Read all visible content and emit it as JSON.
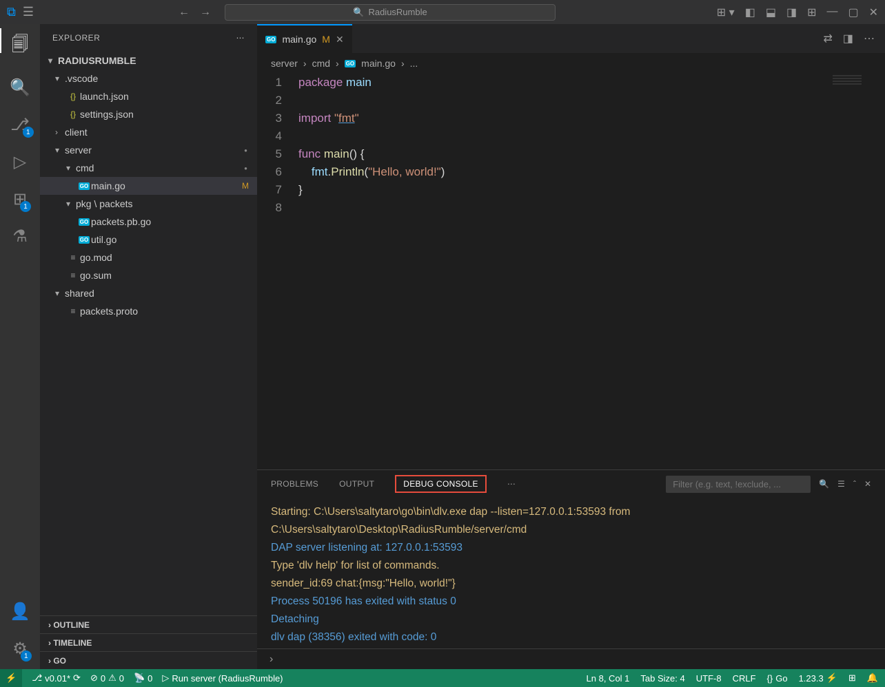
{
  "title": "RadiusRumble",
  "explorer": {
    "label": "EXPLORER"
  },
  "project": {
    "name": "RADIUSRUMBLE"
  },
  "tree": [
    {
      "type": "folder",
      "depth": 1,
      "label": ".vscode",
      "open": true
    },
    {
      "type": "file",
      "depth": 2,
      "label": "launch.json",
      "icon": "json"
    },
    {
      "type": "file",
      "depth": 2,
      "label": "settings.json",
      "icon": "json"
    },
    {
      "type": "folder",
      "depth": 1,
      "label": "client",
      "open": false
    },
    {
      "type": "folder",
      "depth": 1,
      "label": "server",
      "open": true,
      "dot": true
    },
    {
      "type": "folder",
      "depth": 2,
      "label": "cmd",
      "open": true,
      "dot": true
    },
    {
      "type": "file",
      "depth": 3,
      "label": "main.go",
      "icon": "go",
      "status": "M",
      "selected": true
    },
    {
      "type": "folder",
      "depth": 2,
      "label": "pkg \\ packets",
      "open": true
    },
    {
      "type": "file",
      "depth": 3,
      "label": "packets.pb.go",
      "icon": "go"
    },
    {
      "type": "file",
      "depth": 3,
      "label": "util.go",
      "icon": "go"
    },
    {
      "type": "file",
      "depth": 2,
      "label": "go.mod",
      "icon": "lines"
    },
    {
      "type": "file",
      "depth": 2,
      "label": "go.sum",
      "icon": "lines"
    },
    {
      "type": "folder",
      "depth": 1,
      "label": "shared",
      "open": true
    },
    {
      "type": "file",
      "depth": 2,
      "label": "packets.proto",
      "icon": "lines"
    }
  ],
  "sections": {
    "outline": "OUTLINE",
    "timeline": "TIMELINE",
    "go": "GO"
  },
  "tab": {
    "file": "main.go",
    "modified": "M"
  },
  "breadcrumb": {
    "p1": "server",
    "p2": "cmd",
    "p3": "main.go",
    "p4": "..."
  },
  "code": {
    "lines": [
      1,
      2,
      3,
      4,
      5,
      6,
      7,
      8
    ],
    "l1": {
      "a": "package",
      "b": "main"
    },
    "l3": {
      "a": "import",
      "b": "\"",
      "c": "fmt",
      "d": "\""
    },
    "l5": {
      "a": "func",
      "b": "main",
      "c": "() {"
    },
    "l6": {
      "a": "fmt",
      "b": ".",
      "c": "Println",
      "d": "(",
      "e": "\"Hello, world!\"",
      "f": ")"
    },
    "l7": "}"
  },
  "panel": {
    "tabs": {
      "problems": "PROBLEMS",
      "output": "OUTPUT",
      "debug": "DEBUG CONSOLE"
    },
    "filter_placeholder": "Filter (e.g. text, !exclude, ...",
    "lines": [
      {
        "c": "yellow",
        "t": "Starting: C:\\Users\\saltytaro\\go\\bin\\dlv.exe dap --listen=127.0.0.1:53593 from C:\\Users\\saltytaro\\Desktop\\RadiusRumble/server/cmd"
      },
      {
        "c": "blue",
        "t": "DAP server listening at: 127.0.0.1:53593"
      },
      {
        "c": "yellow",
        "t": "Type 'dlv help' for list of commands."
      },
      {
        "c": "yellow",
        "t": "sender_id:69  chat:{msg:\"Hello, world!\"}"
      },
      {
        "c": "blue",
        "t": "Process 50196 has exited with status 0"
      },
      {
        "c": "blue",
        "t": "Detaching"
      },
      {
        "c": "blue",
        "t": "dlv dap (38356) exited with code: 0"
      }
    ]
  },
  "status": {
    "branch": "v0.01*",
    "errors": "0",
    "warnings": "0",
    "ports": "0",
    "run": "Run server (RadiusRumble)",
    "lncol": "Ln 8, Col 1",
    "tabsize": "Tab Size: 4",
    "encoding": "UTF-8",
    "eol": "CRLF",
    "lang": "Go",
    "ver": "1.23.3"
  }
}
